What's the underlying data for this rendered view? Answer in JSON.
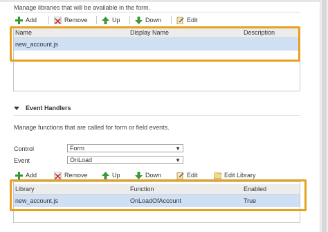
{
  "libraries": {
    "description": "Manage libraries that will be available in the form.",
    "toolbar": {
      "add": "Add",
      "remove": "Remove",
      "up": "Up",
      "down": "Down",
      "edit": "Edit"
    },
    "columns": [
      "Name",
      "Display Name",
      "Description"
    ],
    "rows": [
      {
        "name": "new_account.js",
        "display_name": "",
        "description": ""
      }
    ]
  },
  "event_handlers": {
    "title": "Event Handlers",
    "description": "Manage functions that are called for form or field events.",
    "control_label": "Control",
    "control_value": "Form",
    "event_label": "Event",
    "event_value": "OnLoad",
    "toolbar": {
      "add": "Add",
      "remove": "Remove",
      "up": "Up",
      "down": "Down",
      "edit": "Edit",
      "edit_library": "Edit Library"
    },
    "columns": [
      "Library",
      "Function",
      "Enabled"
    ],
    "rows": [
      {
        "library": "new_account.js",
        "function": "OnLoadOfAccount",
        "enabled": "True"
      }
    ]
  },
  "colors": {
    "highlight": "#e8a020",
    "selected_row": "#cfe0f5",
    "add_green": "#2e9b2e",
    "remove_red": "#c8302c"
  }
}
